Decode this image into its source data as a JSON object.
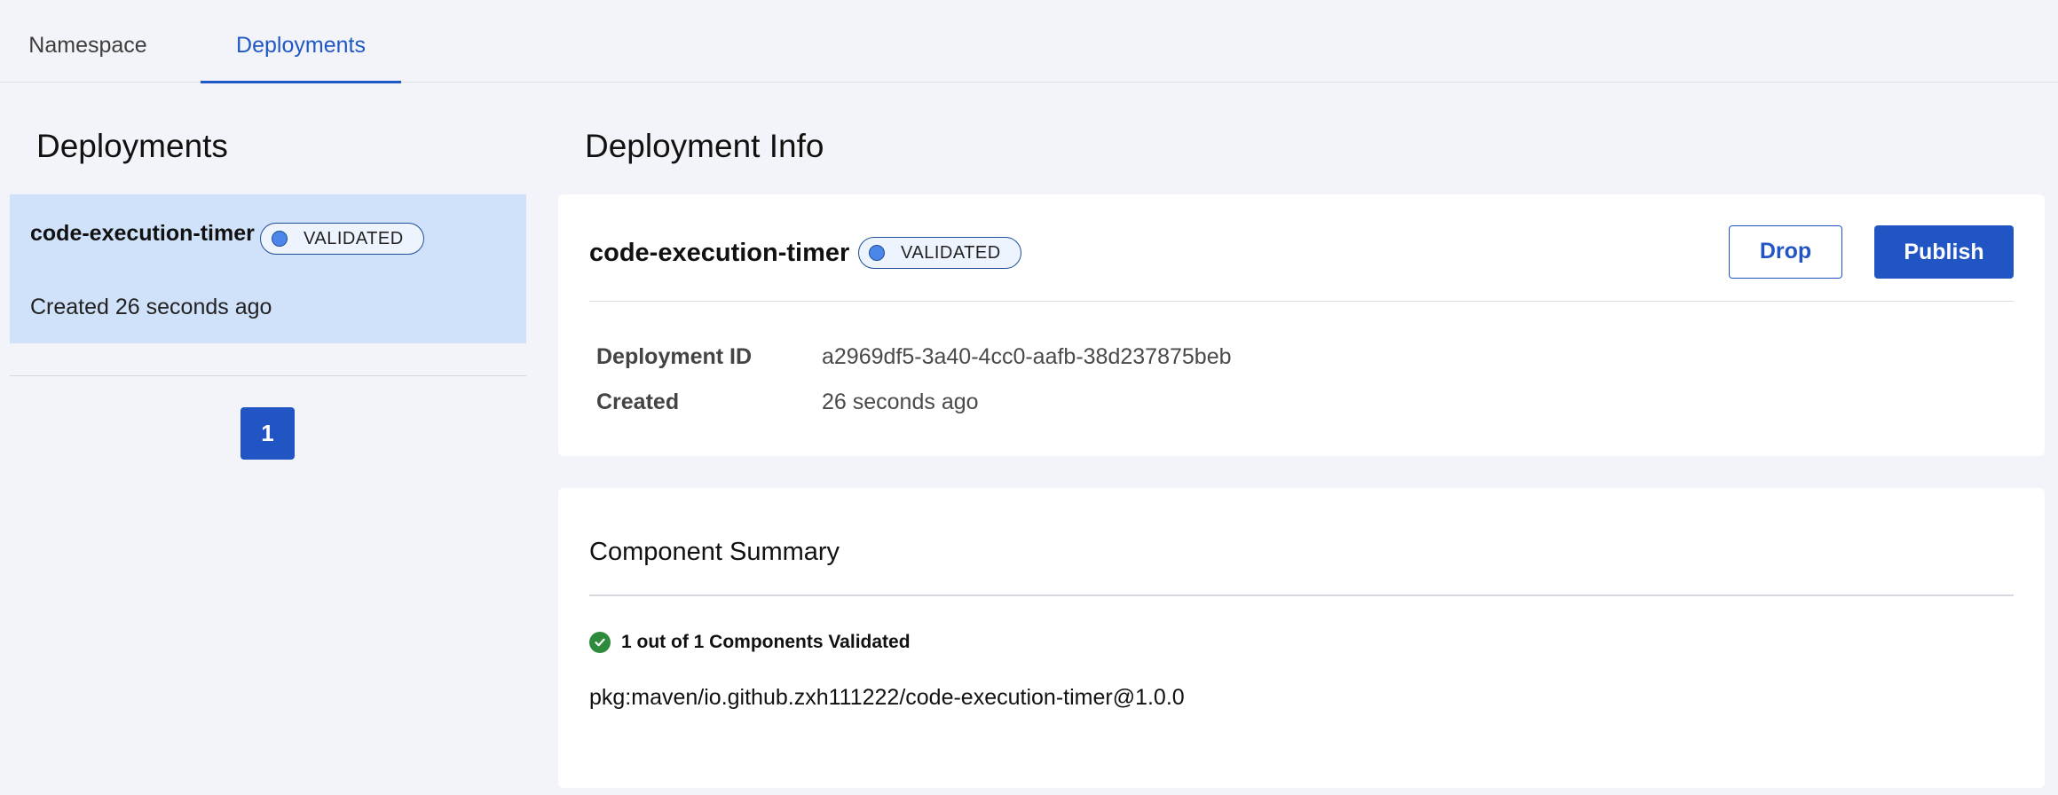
{
  "tabs": [
    {
      "label": "Namespace"
    },
    {
      "label": "Deployments"
    }
  ],
  "left": {
    "title": "Deployments",
    "items": [
      {
        "name": "code-execution-timer",
        "status": "VALIDATED",
        "created": "Created 26 seconds ago"
      }
    ],
    "pagination": {
      "current": "1"
    }
  },
  "info": {
    "title": "Deployment Info",
    "name": "code-execution-timer",
    "status": "VALIDATED",
    "drop_label": "Drop",
    "publish_label": "Publish",
    "fields": [
      {
        "label": "Deployment ID",
        "value": "a2969df5-3a40-4cc0-aafb-38d237875beb"
      },
      {
        "label": "Created",
        "value": "26 seconds ago"
      }
    ]
  },
  "summary": {
    "title": "Component Summary",
    "status_text": "1 out of 1 Components Validated",
    "component": "pkg:maven/io.github.zxh111222/code-execution-timer@1.0.0"
  },
  "colors": {
    "accent": "#2255c4",
    "selected_bg": "#d0e2f9",
    "success": "#2e8b3d",
    "status_dot": "#4c86e8"
  }
}
